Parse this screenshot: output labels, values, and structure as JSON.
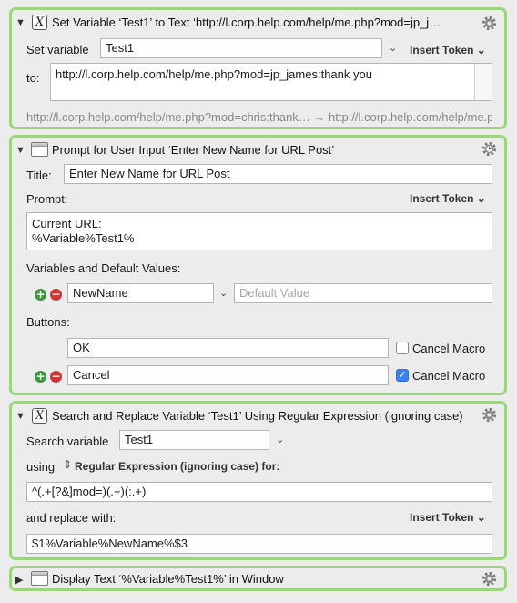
{
  "actions": [
    {
      "title": "Set Variable ‘Test1’ to Text ‘http://l.corp.help.com/help/me.php?mod=jp_j…",
      "set_variable_label": "Set variable",
      "variable_value": "Test1",
      "insert_token": "Insert Token",
      "to_label": "to:",
      "text_value": "http://l.corp.help.com/help/me.php?mod=jp_james:thank you",
      "preview": "http://l.corp.help.com/help/me.php?mod=chris:thank… → http://l.corp.help.com/help/me.php?mod=jp_james:thank you"
    },
    {
      "title": "Prompt for User Input ‘Enter New Name for URL Post’",
      "title_label": "Title:",
      "title_value": "Enter New Name for URL Post",
      "prompt_label": "Prompt:",
      "insert_token": "Insert Token",
      "prompt_line1": "Current URL:",
      "prompt_line2": "%Variable%Test1%",
      "vars_label": "Variables and Default Values:",
      "var_name": "NewName",
      "default_placeholder": "Default Value",
      "buttons_label": "Buttons:",
      "buttons": [
        {
          "label": "OK",
          "cancel_label": "Cancel Macro",
          "cancel_checked": false
        },
        {
          "label": "Cancel",
          "cancel_label": "Cancel Macro",
          "cancel_checked": true
        }
      ]
    },
    {
      "title": "Search and Replace Variable ‘Test1’ Using Regular Expression (ignoring case)",
      "search_label": "Search variable",
      "search_value": "Test1",
      "using_label": "using",
      "mode": "Regular Expression (ignoring case) for:",
      "regex_value": "^(.+[?&]mod=)(.+)(:.+)",
      "replace_label": "and replace with:",
      "insert_token": "Insert Token",
      "replace_value": "$1%Variable%NewName%$3"
    },
    {
      "title": "Display Text ‘%Variable%Test1%’ in Window"
    }
  ],
  "icons": {
    "expanded": "disclosure-down-icon",
    "collapsed": "disclosure-right-icon",
    "variable": "x-variable-icon",
    "window": "window-icon",
    "gear": "gear-icon",
    "timer_gear": "gear-timer-icon"
  },
  "colors": {
    "action_border": "#9cd57e",
    "background": "#ececec",
    "checkbox_on": "#3b82f6"
  }
}
